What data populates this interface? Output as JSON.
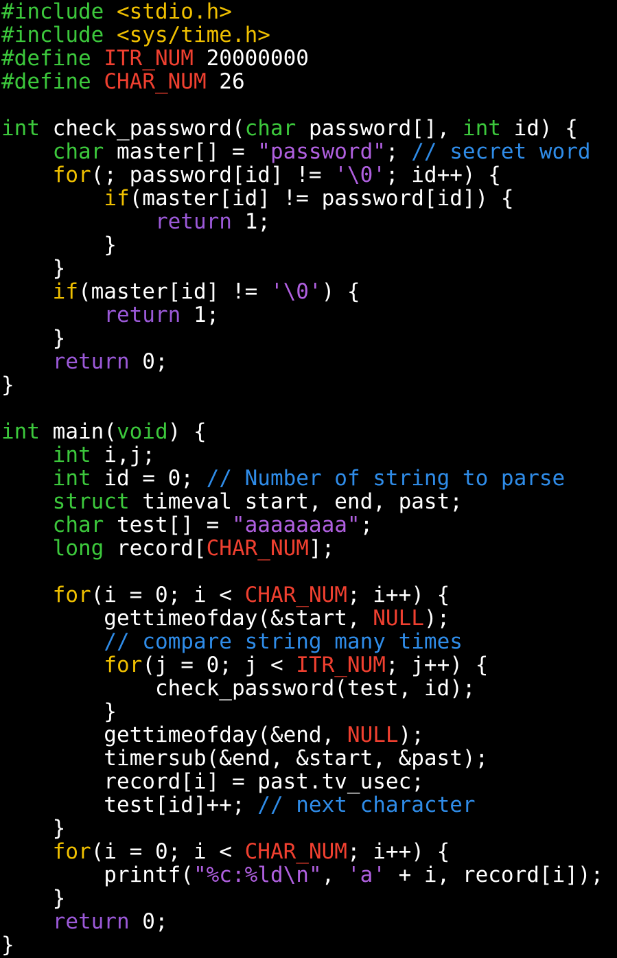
{
  "editor": {
    "background": "#000000",
    "colors": {
      "plain": "#ffffff",
      "pre": "#3cc83c",
      "type": "#3cc83c",
      "kw": "#f0c000",
      "ret": "#9b59d8",
      "str": "#b060e0",
      "macro": "#f04030",
      "comment": "#2f8ce8"
    },
    "lines": [
      [
        {
          "t": "pre",
          "v": "#include"
        },
        {
          "t": "plain",
          "v": " "
        },
        {
          "t": "kw",
          "v": "<stdio.h>"
        }
      ],
      [
        {
          "t": "pre",
          "v": "#include"
        },
        {
          "t": "plain",
          "v": " "
        },
        {
          "t": "kw",
          "v": "<sys/time.h>"
        }
      ],
      [
        {
          "t": "pre",
          "v": "#define"
        },
        {
          "t": "plain",
          "v": " "
        },
        {
          "t": "macro",
          "v": "ITR_NUM"
        },
        {
          "t": "plain",
          "v": " 20000000"
        }
      ],
      [
        {
          "t": "pre",
          "v": "#define"
        },
        {
          "t": "plain",
          "v": " "
        },
        {
          "t": "macro",
          "v": "CHAR_NUM"
        },
        {
          "t": "plain",
          "v": " 26"
        }
      ],
      [],
      [
        {
          "t": "type",
          "v": "int"
        },
        {
          "t": "plain",
          "v": " check_password("
        },
        {
          "t": "type",
          "v": "char"
        },
        {
          "t": "plain",
          "v": " password[], "
        },
        {
          "t": "type",
          "v": "int"
        },
        {
          "t": "plain",
          "v": " id) {"
        }
      ],
      [
        {
          "t": "plain",
          "v": "    "
        },
        {
          "t": "type",
          "v": "char"
        },
        {
          "t": "plain",
          "v": " master[] = "
        },
        {
          "t": "str",
          "v": "\"password\""
        },
        {
          "t": "plain",
          "v": "; "
        },
        {
          "t": "comment",
          "v": "// secret word"
        }
      ],
      [
        {
          "t": "plain",
          "v": "    "
        },
        {
          "t": "kw",
          "v": "for"
        },
        {
          "t": "plain",
          "v": "(; password[id] != "
        },
        {
          "t": "str",
          "v": "'\\0'"
        },
        {
          "t": "plain",
          "v": "; id++) {"
        }
      ],
      [
        {
          "t": "plain",
          "v": "        "
        },
        {
          "t": "kw",
          "v": "if"
        },
        {
          "t": "plain",
          "v": "(master[id] != password[id]) {"
        }
      ],
      [
        {
          "t": "plain",
          "v": "            "
        },
        {
          "t": "ret",
          "v": "return"
        },
        {
          "t": "plain",
          "v": " 1;"
        }
      ],
      [
        {
          "t": "plain",
          "v": "        }"
        }
      ],
      [
        {
          "t": "plain",
          "v": "    }"
        }
      ],
      [
        {
          "t": "plain",
          "v": "    "
        },
        {
          "t": "kw",
          "v": "if"
        },
        {
          "t": "plain",
          "v": "(master[id] != "
        },
        {
          "t": "str",
          "v": "'\\0'"
        },
        {
          "t": "plain",
          "v": ") {"
        }
      ],
      [
        {
          "t": "plain",
          "v": "        "
        },
        {
          "t": "ret",
          "v": "return"
        },
        {
          "t": "plain",
          "v": " 1;"
        }
      ],
      [
        {
          "t": "plain",
          "v": "    }"
        }
      ],
      [
        {
          "t": "plain",
          "v": "    "
        },
        {
          "t": "ret",
          "v": "return"
        },
        {
          "t": "plain",
          "v": " 0;"
        }
      ],
      [
        {
          "t": "plain",
          "v": "}"
        }
      ],
      [],
      [
        {
          "t": "type",
          "v": "int"
        },
        {
          "t": "plain",
          "v": " main("
        },
        {
          "t": "type",
          "v": "void"
        },
        {
          "t": "plain",
          "v": ") {"
        }
      ],
      [
        {
          "t": "plain",
          "v": "    "
        },
        {
          "t": "type",
          "v": "int"
        },
        {
          "t": "plain",
          "v": " i,j;"
        }
      ],
      [
        {
          "t": "plain",
          "v": "    "
        },
        {
          "t": "type",
          "v": "int"
        },
        {
          "t": "plain",
          "v": " id = 0; "
        },
        {
          "t": "comment",
          "v": "// Number of string to parse"
        }
      ],
      [
        {
          "t": "plain",
          "v": "    "
        },
        {
          "t": "type",
          "v": "struct"
        },
        {
          "t": "plain",
          "v": " timeval start, end, past;"
        }
      ],
      [
        {
          "t": "plain",
          "v": "    "
        },
        {
          "t": "type",
          "v": "char"
        },
        {
          "t": "plain",
          "v": " test[] = "
        },
        {
          "t": "str",
          "v": "\"aaaaaaaa\""
        },
        {
          "t": "plain",
          "v": ";"
        }
      ],
      [
        {
          "t": "plain",
          "v": "    "
        },
        {
          "t": "type",
          "v": "long"
        },
        {
          "t": "plain",
          "v": " record["
        },
        {
          "t": "macro",
          "v": "CHAR_NUM"
        },
        {
          "t": "plain",
          "v": "];"
        }
      ],
      [],
      [
        {
          "t": "plain",
          "v": "    "
        },
        {
          "t": "kw",
          "v": "for"
        },
        {
          "t": "plain",
          "v": "(i = 0; i < "
        },
        {
          "t": "macro",
          "v": "CHAR_NUM"
        },
        {
          "t": "plain",
          "v": "; i++) {"
        }
      ],
      [
        {
          "t": "plain",
          "v": "        gettimeofday(&start, "
        },
        {
          "t": "macro",
          "v": "NULL"
        },
        {
          "t": "plain",
          "v": ");"
        }
      ],
      [
        {
          "t": "plain",
          "v": "        "
        },
        {
          "t": "comment",
          "v": "// compare string many times"
        }
      ],
      [
        {
          "t": "plain",
          "v": "        "
        },
        {
          "t": "kw",
          "v": "for"
        },
        {
          "t": "plain",
          "v": "(j = 0; j < "
        },
        {
          "t": "macro",
          "v": "ITR_NUM"
        },
        {
          "t": "plain",
          "v": "; j++) {"
        }
      ],
      [
        {
          "t": "plain",
          "v": "            check_password(test, id);"
        }
      ],
      [
        {
          "t": "plain",
          "v": "        }"
        }
      ],
      [
        {
          "t": "plain",
          "v": "        gettimeofday(&end, "
        },
        {
          "t": "macro",
          "v": "NULL"
        },
        {
          "t": "plain",
          "v": ");"
        }
      ],
      [
        {
          "t": "plain",
          "v": "        timersub(&end, &start, &past);"
        }
      ],
      [
        {
          "t": "plain",
          "v": "        record[i] = past.tv_usec;"
        }
      ],
      [
        {
          "t": "plain",
          "v": "        test[id]++; "
        },
        {
          "t": "comment",
          "v": "// next character"
        }
      ],
      [
        {
          "t": "plain",
          "v": "    }"
        }
      ],
      [
        {
          "t": "plain",
          "v": "    "
        },
        {
          "t": "kw",
          "v": "for"
        },
        {
          "t": "plain",
          "v": "(i = 0; i < "
        },
        {
          "t": "macro",
          "v": "CHAR_NUM"
        },
        {
          "t": "plain",
          "v": "; i++) {"
        }
      ],
      [
        {
          "t": "plain",
          "v": "        printf("
        },
        {
          "t": "str",
          "v": "\"%c:%ld\\n\""
        },
        {
          "t": "plain",
          "v": ", "
        },
        {
          "t": "str",
          "v": "'a'"
        },
        {
          "t": "plain",
          "v": " + i, record[i]);"
        }
      ],
      [
        {
          "t": "plain",
          "v": "    }"
        }
      ],
      [
        {
          "t": "plain",
          "v": "    "
        },
        {
          "t": "ret",
          "v": "return"
        },
        {
          "t": "plain",
          "v": " 0;"
        }
      ],
      [
        {
          "t": "plain",
          "v": "}"
        }
      ]
    ]
  }
}
